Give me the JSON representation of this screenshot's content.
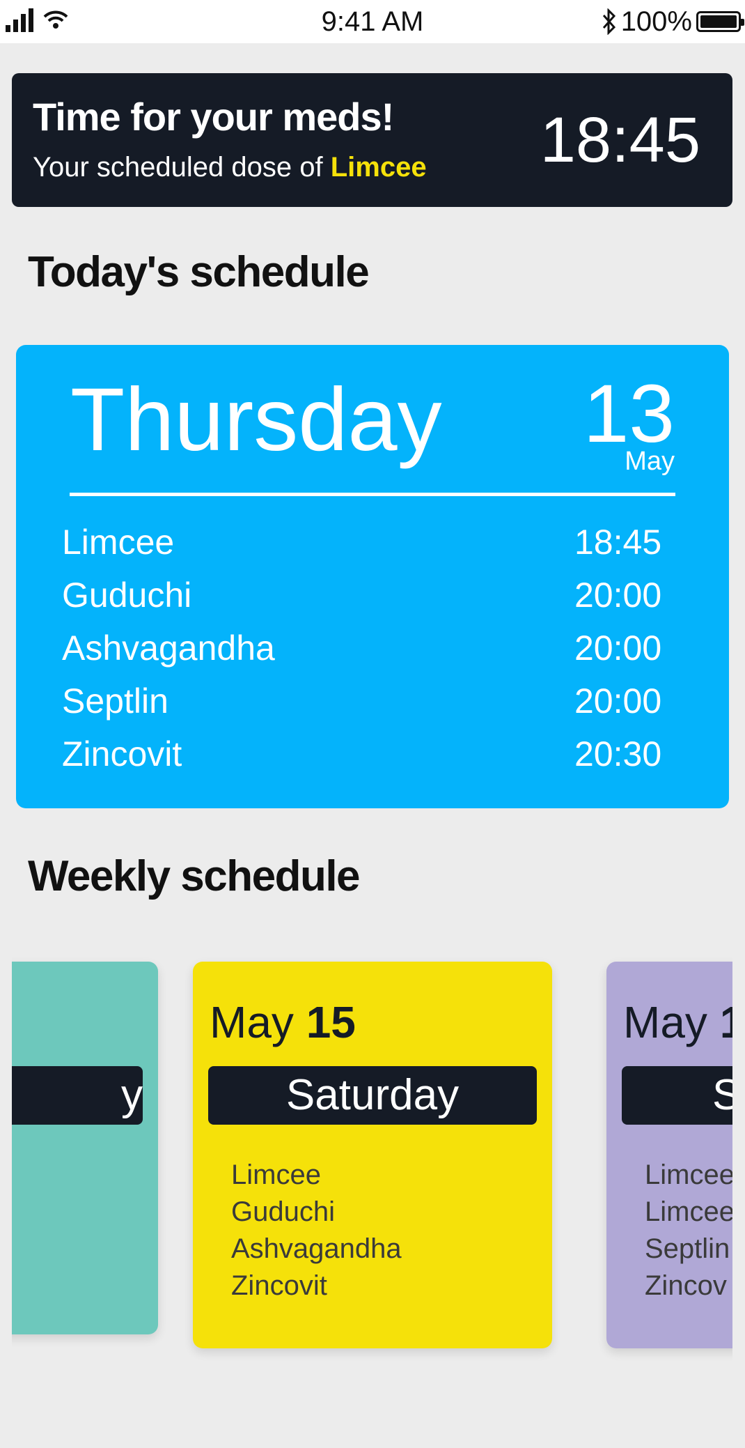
{
  "status_bar": {
    "time": "9:41 AM",
    "battery": "100%",
    "icons": [
      "signal-icon",
      "wifi-icon",
      "bluetooth-icon",
      "battery-icon"
    ]
  },
  "banner": {
    "title": "Time for your meds!",
    "subtitle_prefix": "Your scheduled dose of ",
    "medicine": "Limcee",
    "time": "18:45",
    "colors": {
      "background": "#151b26",
      "highlight": "#f5e10a"
    }
  },
  "today": {
    "heading": "Today's schedule",
    "day": "Thursday",
    "date": "13",
    "month": "May",
    "color": "#04b3fb",
    "meds": [
      {
        "name": "Limcee",
        "time": "18:45"
      },
      {
        "name": "Guduchi",
        "time": "20:00"
      },
      {
        "name": "Ashvagandha",
        "time": "20:00"
      },
      {
        "name": "Septlin",
        "time": "20:00"
      },
      {
        "name": "Zincovit",
        "time": "20:30"
      }
    ]
  },
  "weekly": {
    "heading": "Weekly schedule",
    "cards": [
      {
        "month": "",
        "date": "",
        "day": "y",
        "meds": [],
        "color": "#6dc8bc"
      },
      {
        "month": "May",
        "date": "15",
        "day": "Saturday",
        "meds": [
          "Limcee",
          "Guduchi",
          "Ashvagandha",
          "Zincovit"
        ],
        "color": "#f5e10a"
      },
      {
        "month": "May",
        "date": "1",
        "day": "S",
        "meds": [
          "Limcee",
          "Limcee",
          "Septlin",
          "Zincov"
        ],
        "color": "#b0a8d6"
      }
    ]
  }
}
